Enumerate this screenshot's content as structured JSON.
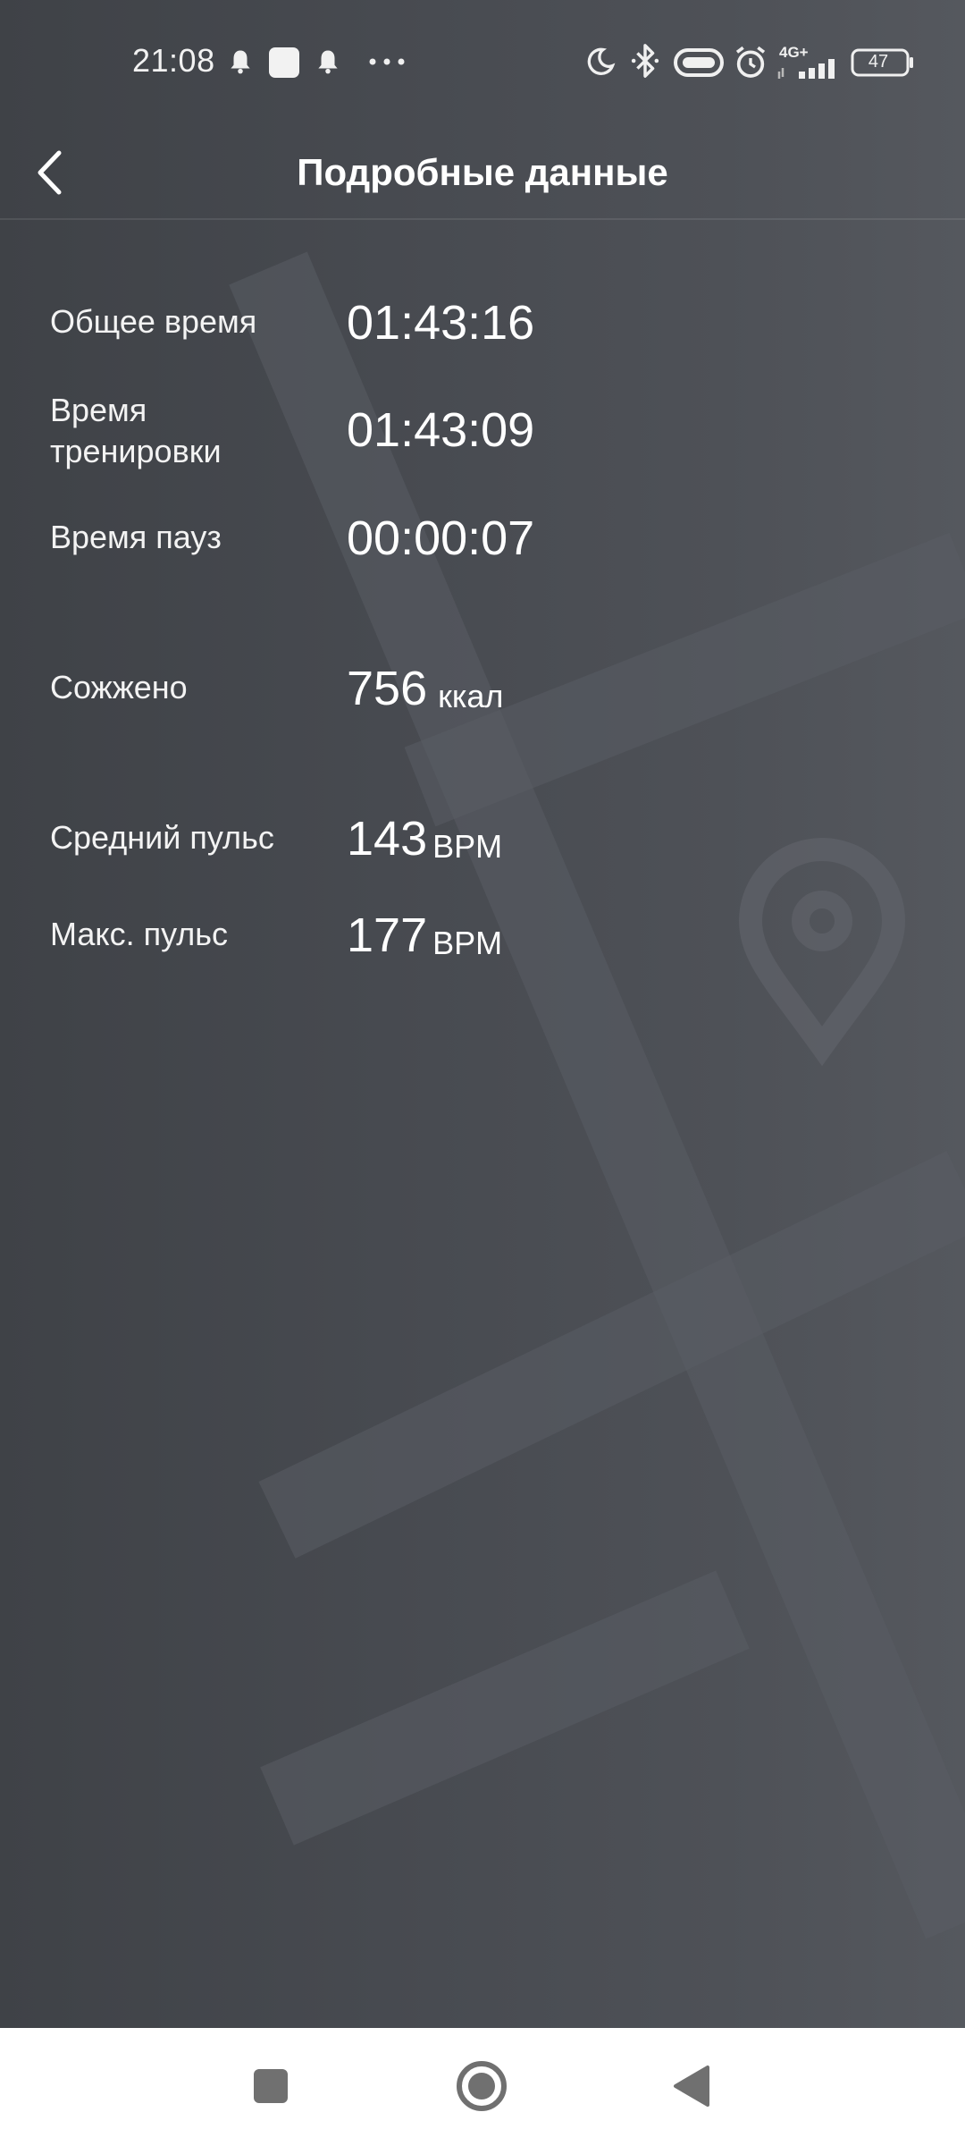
{
  "status_bar": {
    "time": "21:08",
    "network": "4G+",
    "battery": "47",
    "icons": [
      "notification-bell-icon",
      "app-notification-icon",
      "notification-bell-icon",
      "more-notifications-icon",
      "do-not-disturb-moon-icon",
      "bluetooth-icon",
      "vibrate-icon",
      "alarm-icon",
      "signal-icon",
      "battery-icon"
    ]
  },
  "header": {
    "title": "Подробные данные",
    "back_icon": "chevron-left-icon"
  },
  "stats": {
    "total_time": {
      "label": "Общее время",
      "value": "01:43:16"
    },
    "workout_time": {
      "label": "Время тренировки",
      "value": "01:43:09"
    },
    "pause_time": {
      "label": "Время пауз",
      "value": "00:00:07"
    },
    "calories": {
      "label": "Сожжено",
      "value": "756",
      "unit": "ккал"
    },
    "avg_pulse": {
      "label": "Средний пульс",
      "value": "143",
      "unit": "BPM"
    },
    "max_pulse": {
      "label": "Макс. пульс",
      "value": "177",
      "unit": "BPM"
    }
  },
  "nav_bar": {
    "icons": [
      "recent-apps-icon",
      "home-icon",
      "back-triangle-icon"
    ]
  },
  "colors": {
    "background_dark": "#3f4247",
    "background_light": "#55585e",
    "text": "#ffffff",
    "nav_bar": "#ffffff",
    "nav_icons": "#707070"
  }
}
